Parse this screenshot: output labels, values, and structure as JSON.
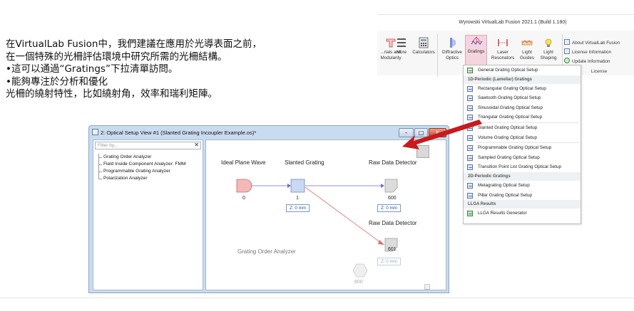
{
  "intro": {
    "lines": [
      "在VirtualLab Fusion中，我們建議在應用於光導表面之前，",
      "在一個特殊的光柵評估環境中研究所需的光柵結構。",
      "•這可以通過“Gratings”下拉清單訪問。",
      "•能夠專注於分析和優化",
      "光柵的繞射特性，比如繞射角，效率和瑞利矩陣。"
    ]
  },
  "ribbon": {
    "title": "Wyrowski VirtualLab Fusion 2021.1 (Build 1.180)",
    "buttons": [
      {
        "label": "...rials and\nModularity",
        "icon": "modularity-icon"
      },
      {
        "label": "More",
        "icon": "more-icon"
      },
      {
        "label": "Calculators",
        "icon": "calculator-icon"
      },
      {
        "label": "Diffractive\nOptics",
        "icon": "diffractive-optics-icon"
      },
      {
        "label": "Gratings",
        "icon": "gratings-icon"
      },
      {
        "label": "Laser\nResonators",
        "icon": "laser-resonator-icon"
      },
      {
        "label": "Light\nGuides",
        "icon": "light-guide-icon"
      },
      {
        "label": "Light\nShaping",
        "icon": "light-shaping-icon"
      }
    ],
    "license_items": [
      "About VirtualLab Fusion",
      "License Information",
      "Update Information"
    ],
    "license_group": "License",
    "selected_color": "#f4d4de"
  },
  "dropdown": {
    "general": "General Grating Optical Setup",
    "header_1d": "1D-Periodic (Lamellar) Gratings",
    "items_1d_a": [
      "Rectangular Grating Optical Setup",
      "Sawtooth Grating Optical Setup",
      "Sinusoidal Grating Optical Setup",
      "Triangular Grating Optical Setup"
    ],
    "items_1d_b": [
      "Slanted Grating Optical Setup",
      "Volume Grating Optical Setup"
    ],
    "items_1d_c": [
      "Programmable Grating Optical Setup",
      "Sampled Grating Optical Setup",
      "Transition Point List Grating Optical Setup"
    ],
    "header_2d": "2D-Periodic Gratings",
    "items_2d": [
      "Metagrating Optical Setup",
      "Pillar Grating Optical Setup"
    ],
    "header_llga": "LLGA Results",
    "llga_item": "LLGA Results Generator"
  },
  "window": {
    "title": "2: Optical Setup View #1 (Slanted Grating Incoupler Example.os)*",
    "filter_placeholder": "Filter by...",
    "filter_clear": "✕",
    "min_glyph": "–",
    "max_glyph": "□",
    "close_glyph": "✕",
    "tree_items": [
      "Grating Order Analyzer",
      "Field Inside Component Analyzer: FMM",
      "Programmable Grating Analyzer",
      "Polarization Analyzer"
    ]
  },
  "canvas": {
    "source_label": "Ideal Plane Wave",
    "source_id": "0",
    "grating_label": "Slanted Grating",
    "grating_id": "1",
    "grating_z": "Z: 0 mm",
    "det1_label": "Raw Data Detector",
    "det1_id": "600",
    "det1_z": "Z: 0 mm",
    "det2_label": "Raw Data Detector",
    "det2_id": "601",
    "det2_z": "Z: 0 mm",
    "analyzer_label": "Grating Order Analyzer",
    "analyzer_id": "800",
    "colors": {
      "source": "#f3b8b8",
      "grating": "#c9d9f3",
      "detector": "#dcdcdc",
      "link_blue": "#6a6ad6",
      "link_red": "#e07070",
      "arrow": "#c8191e"
    }
  }
}
